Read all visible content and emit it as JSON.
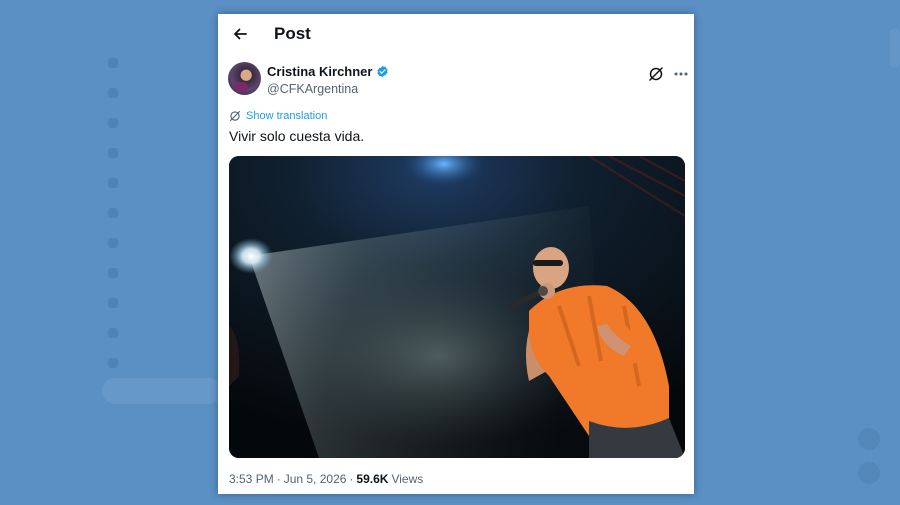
{
  "header": {
    "title": "Post"
  },
  "author": {
    "name": "Cristina Kirchner",
    "handle": "@CFKArgentina"
  },
  "post": {
    "translate_label": "Show translation",
    "text": "Vivir solo cuesta vida.",
    "time": "3:53 PM",
    "separator": "·",
    "date": "Jun 5, 2026",
    "views_count": "59.6K",
    "views_label": "Views"
  },
  "colors": {
    "accent": "#1d9bf0",
    "backdrop": "#5a90c4",
    "text": "#0f1419",
    "muted": "#536471",
    "shirt": "#f07a2a"
  },
  "icons": [
    "back-arrow-icon",
    "verified-badge-icon",
    "grok-icon",
    "more-icon",
    "translate-icon"
  ]
}
